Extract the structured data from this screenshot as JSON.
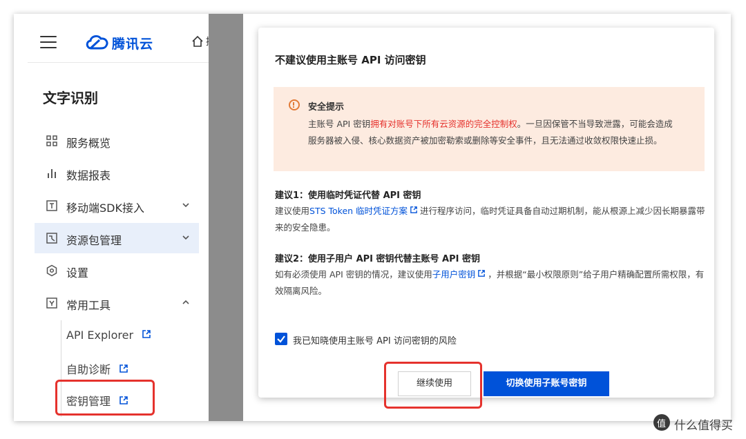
{
  "header": {
    "brand": "腾讯云",
    "home_label": "控制台"
  },
  "sidebar": {
    "product_title": "文字识别",
    "items": [
      {
        "label": "服务概览",
        "icon": "grid-icon"
      },
      {
        "label": "数据报表",
        "icon": "bar-chart-icon"
      },
      {
        "label": "移动端SDK接入",
        "icon": "sdk-icon",
        "expand": "chevron-down"
      },
      {
        "label": "资源包管理",
        "icon": "package-icon",
        "expand": "chevron-down",
        "active": true
      },
      {
        "label": "设置",
        "icon": "settings-icon"
      },
      {
        "label": "常用工具",
        "icon": "tools-icon",
        "expand": "chevron-up"
      }
    ],
    "sub_items": [
      {
        "label": "API Explorer"
      },
      {
        "label": "自助诊断"
      },
      {
        "label": "密钥管理",
        "highlighted": true
      }
    ]
  },
  "dialog": {
    "title": "不建议使用主账号 API 访问密钥",
    "warning": {
      "title": "安全提示",
      "body_prefix": "主账号 API 密钥",
      "body_highlight": "拥有对账号下所有云资源的完全控制权",
      "body_rest": "。一旦因保管不当导致泄露，可能会造成服务器被入侵、核心数据资产被加密勒索或删除等安全事件，且无法通过收敛权限快速止损。"
    },
    "suggestion1": {
      "title": "建议1：使用临时凭证代替 API 密钥",
      "pre": "建议使用",
      "link": "STS Token 临时凭证方案",
      "post": "进行程序访问，临时凭证具备自动过期机制，能从根源上减少因长期暴露带来的安全隐患。"
    },
    "suggestion2": {
      "title": "建议2：使用子用户 API 密钥代替主账号 API 密钥",
      "pre": "如有必须使用 API 密钥的情况，建议使用",
      "link": "子用户密钥",
      "post": "，并根据“最小权限原则”给子用户精确配置所需权限，有效隔离风险。"
    },
    "checkbox_label": "我已知晓使用主账号 API 访问密钥的风险",
    "checkbox_checked": true,
    "btn_continue": "继续使用",
    "btn_switch": "切换使用子账号密钥"
  },
  "watermark": {
    "text": "什么值得买"
  },
  "colors": {
    "brand_blue": "#0052d9",
    "warning_bg": "#fdebe0",
    "highlight_red": "#e5322d",
    "warning_orange": "#e27b38"
  }
}
